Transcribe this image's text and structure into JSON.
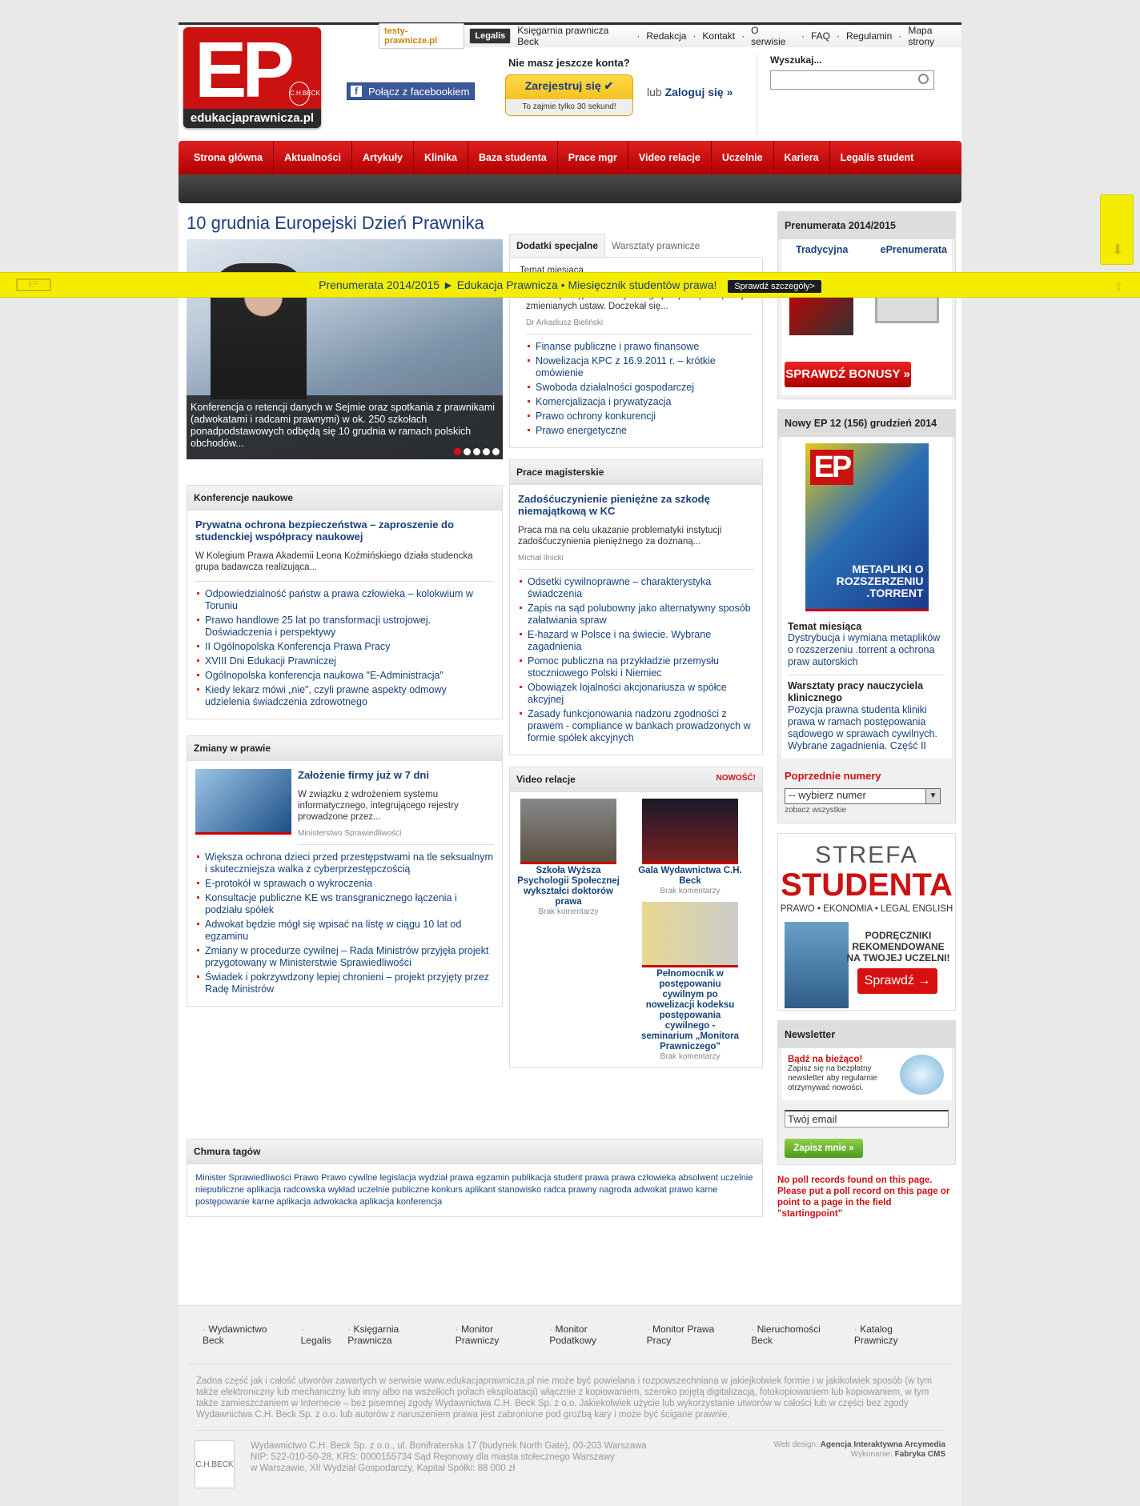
{
  "header": {
    "logo_text": "EP",
    "logo_domain": "edukacjaprawnicza.pl",
    "logo_beck": "C.H.BECK",
    "top_links_external": [
      {
        "label": "testy-prawnicze.pl"
      },
      {
        "label": "Legalis"
      }
    ],
    "top_links": [
      {
        "label": "Księgarnia prawnicza Beck"
      },
      {
        "label": "Redakcja"
      },
      {
        "label": "Kontakt"
      },
      {
        "label": "O serwisie"
      },
      {
        "label": "FAQ"
      },
      {
        "label": "Regulamin"
      },
      {
        "label": "Mapa strony"
      }
    ],
    "facebook_label": "Połącz z facebookiem",
    "register_question": "Nie masz jeszcze konta?",
    "register_button": "Zarejestruj się",
    "register_note": "To zajmie tylko 30 sekund!",
    "login_prefix": "lub",
    "login_label": "Zaloguj się »",
    "search_label": "Wyszukaj...",
    "search_placeholder": ""
  },
  "nav": [
    {
      "label": "Strona główna"
    },
    {
      "label": "Aktualności"
    },
    {
      "label": "Artykuły"
    },
    {
      "label": "Klinika"
    },
    {
      "label": "Baza studenta"
    },
    {
      "label": "Prace mgr"
    },
    {
      "label": "Video relacje"
    },
    {
      "label": "Uczelnie"
    },
    {
      "label": "Kariera"
    },
    {
      "label": "Legalis student"
    }
  ],
  "banner": {
    "text": "Prenumerata 2014/2015 ► Edukacja Prawnicza • Miesięcznik studentów prawa!",
    "button": "Sprawdź szczegóły>"
  },
  "featured": {
    "title": "10 grudnia Europejski Dzień Prawnika",
    "caption": "Konferencja o retencji danych w Sejmie oraz spotkania z prawnikami (adwokatami i radcami prawnymi) w ok. 250 szkołach ponadpodstawowych odbędą się 10 grudnia w ramach polskich obchodów..."
  },
  "tabs": {
    "active": "Dodatki specjalne",
    "inactive": "Warsztaty prawnicze",
    "label": "Temat miesiąca",
    "summary": "Kodeks postępowania cywilnego jest jedną z częściej zmienianych ustaw. Doczekał się...",
    "author": "Dr Arkadiusz Bieliński",
    "items": [
      "Finanse publiczne i prawo finansowe",
      "Nowelizacja KPC z 16.9.2011 r. – krótkie omówienie",
      "Swoboda działalności gospodarczej",
      "Komercjalizacja i prywatyzacja",
      "Prawo ochrony konkurencji",
      "Prawo energetyczne"
    ]
  },
  "konferencje": {
    "title": "Konferencje naukowe",
    "lead": "Prywatna ochrona bezpieczeństwa – zaproszenie do studenckiej współpracy naukowej",
    "summary": "W Kolegium Prawa Akademii Leona Koźmińskiego działa studencka grupa badawcza realizująca...",
    "items": [
      "Odpowiedzialność państw a prawa człowieka – kolokwium w Toruniu",
      "Prawo handlowe 25 lat po transformacji ustrojowej. Doświadczenia i perspektywy",
      "II Ogólnopolska Konferencja Prawa Pracy",
      "XVIII Dni Edukacji Prawniczej",
      "Ogólnopolska konferencja naukowa \"E-Administracja\"",
      "Kiedy lekarz mówi „nie\", czyli prawne aspekty odmowy udzielenia świadczenia zdrowotnego"
    ]
  },
  "prace": {
    "title": "Prace magisterskie",
    "lead": "Zadośćuczynienie pieniężne za szkodę niemajątkową w KC",
    "summary": "Praca ma na celu ukazanie problematyki instytucji zadośćuczynienia pieniężnego za doznaną...",
    "author": "Michał Ilnicki",
    "items": [
      "Odsetki cywilnoprawne – charakterystyka świadczenia",
      "Zapis na sąd polubowny jako alternatywny sposób załatwiania spraw",
      "E-hazard w Polsce i na świecie. Wybrane zagadnienia",
      "Pomoc publiczna na przykładzie przemysłu stoczniowego Polski i Niemiec",
      "Obowiązek lojalności akcjonariusza w spółce akcyjnej",
      "Zasady funkcjonowania nadzoru zgodności z prawem - compliance w bankach prowadzonych w formie spółek akcyjnych"
    ]
  },
  "zmiany": {
    "title": "Zmiany w prawie",
    "lead": "Założenie firmy już w 7 dni",
    "summary": "W związku z wdrożeniem systemu informatycznego, integrującego rejestry prowadzone przez...",
    "author": "Ministerstwo Sprawiedliwości",
    "items": [
      "Większa ochrona dzieci przed przestępstwami na tle seksualnym i skuteczniejsza walka z cyberprzestępczością",
      "E-protokół w sprawach o wykroczenia",
      "Konsultacje publiczne KE ws transgranicznego łączenia i podziału spółek",
      "Adwokat będzie mógł się wpisać na listę w ciągu 10 lat od egzaminu",
      "Zmiany w procedurze cywilnej – Rada Ministrów przyjęła projekt przygotowany w Ministerstwie Sprawiedliwości",
      "Świadek i pokrzywdzony lepiej chronieni – projekt przyjęty przez Radę Ministrów"
    ]
  },
  "video": {
    "title": "Video relacje",
    "new_label": "NOWOŚĆ!",
    "items": [
      {
        "title": "Szkoła Wyższa Psychologii Społecznej wykształci doktorów prawa",
        "meta": "Brak komentarzy"
      },
      {
        "title": "Gala Wydawnictwa C.H. Beck",
        "meta": "Brak komentarzy"
      },
      {
        "title": "Pełnomocnik w postępowaniu cywilnym po nowelizacji kodeksu postępowania cywilnego - seminarium „Monitora Prawniczego\"",
        "meta": "Brak komentarzy"
      }
    ]
  },
  "tags": {
    "title": "Chmura tagów",
    "text": "Minister Sprawiedliwości Prawo Prawo cywilne legislacja wydział prawa egzamin publikacja student prawa prawa człowieka absolwent uczelnie niepubliczne aplikacja radcowska wykład uczelnie publiczne konkurs aplikant stanowisko radca prawny nagroda adwokat prawo karne postępowanie karne aplikacja adwokacka aplikacja konferencja"
  },
  "sidebar": {
    "prenumerata_title": "Prenumerata 2014/2015",
    "trad": "Tradycyjna",
    "eprem": "ePrenumerata",
    "bonus_button": "SPRAWDŹ BONUSY »",
    "issue_title": "Nowy EP 12 (156) grudzień 2014",
    "cover_text": "METAPLIKI O ROZSZERZENIU .TORRENT",
    "temat_label": "Temat miesiąca",
    "temat_text": "Dystrybucja i wymiana metaplików o rozszerzeniu .torrent a ochrona praw autorskich",
    "warsztaty_label": "Warsztaty pracy nauczyciela klinicznego",
    "warsztaty_text": "Pozycja prawna studenta kliniki prawa w ramach postępowania sądowego w sprawach cywilnych. Wybrane zagadnienia. Część II",
    "poprzednie_title": "Poprzednie numery",
    "poprzednie_select": "-- wybierz numer",
    "poprzednie_all": "zobacz wszystkie",
    "strefa1": "STREFA",
    "strefa2": "STUDENTA",
    "strefa3": "PRAWO • EKONOMIA • LEGAL ENGLISH",
    "strefa4": "PODRĘCZNIKI REKOMENDOWANE NA TWOJEJ UCZELNI!",
    "strefa5": "Sprawdź →",
    "newsletter_title": "Newsletter",
    "newsletter_head": "Bądź na bieżąco!",
    "newsletter_text": "Zapisz się na bezpłatny newsletter aby regularnie otrzymywać nowości.",
    "newsletter_input": "Twój email",
    "newsletter_button": "Zapisz mnie »",
    "poll": "No poll records found on this page. Please put a poll record on this page or point to a page in the field \"startingpoint\""
  },
  "footer": {
    "links": [
      {
        "label": "Wydawnictwo Beck"
      },
      {
        "label": "Legalis"
      },
      {
        "label": "Księgarnia Prawnicza"
      },
      {
        "label": "Monitor Prawniczy"
      },
      {
        "label": "Monitor Podatkowy"
      },
      {
        "label": "Monitor Prawa Pracy"
      },
      {
        "label": "Nieruchomości Beck"
      },
      {
        "label": "Katalog Prawniczy"
      }
    ],
    "copyright": "Żadna część jak i całość utworów zawartych w serwisie www.edukacjaprawnicza.pl nie może być powielana i rozpowszechniana w jakiejkolwiek formie i w jakikolwiek sposób (w tym także elektroniczny lub mechaniczny lub inny albo na wszelkich polach eksploatacji) włącznie z kopiowaniem, szeroko pojętą digitalizacją, fotokopiowaniem lub kopiowaniem, w tym także zamieszczaniem w Internecie – bez pisemnej zgody Wydawnictwa C.H. Beck Sp. z o.o. Jakiekolwiek użycie lub wykorzystanie utworów w całości lub w części bez zgody Wydawnictwa C.H. Beck Sp. z o.o. lub autorów z naruszeniem prawa jest zabronione pod groźbą kary i może być ścigane prawnie.",
    "address1": "Wydawnictwo C.H. Beck Sp. z o.o., ul. Bonifraterska 17 (budynek North Gate), 00-203 Warszawa",
    "address2": "NIP: 522-010-50-28, KRS: 0000155734 Sąd Rejonowy dla miasta stołecznego Warszawy",
    "address3": "w Warszawie, XII Wydział Gospodarczy, Kapitał Spółki: 88 000 zł",
    "webdesign_label": "Web design:",
    "webdesign": "Agencja Interaktywna Arcymedia",
    "wykonanie_label": "Wykonanie:",
    "wykonanie": "Fabryka CMS",
    "beck_logo": "C.H.BECK"
  }
}
